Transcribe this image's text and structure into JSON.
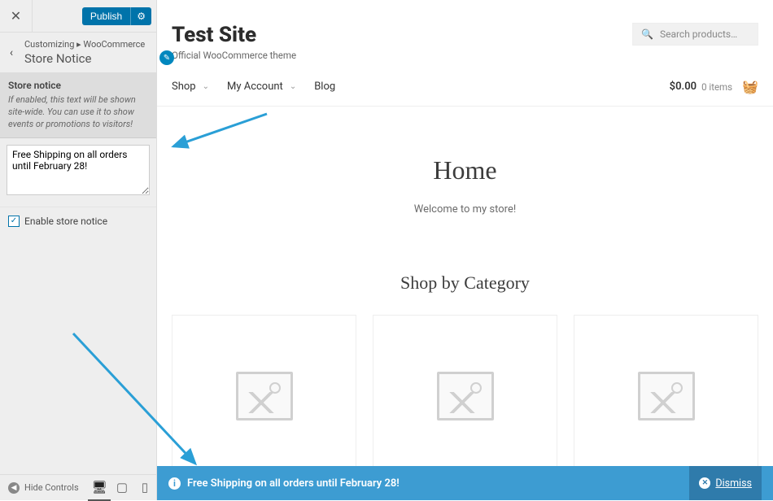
{
  "sidebar": {
    "publish_label": "Publish",
    "breadcrumb_trail": "Customizing ▸ WooCommerce",
    "page_title": "Store Notice",
    "section_title": "Store notice",
    "section_help": "If enabled, this text will be shown site-wide. You can use it to show events or promotions to visitors!",
    "notice_value": "Free Shipping on all orders until February 28!",
    "enable_label": "Enable store notice",
    "enable_checked": true,
    "hide_controls_label": "Hide Controls"
  },
  "preview": {
    "site_title": "Test Site",
    "tagline": "Official WooCommerce theme",
    "search_placeholder": "Search products…",
    "menu": {
      "shop": "Shop",
      "account": "My Account",
      "blog": "Blog"
    },
    "cart": {
      "price": "$0.00",
      "items": "0 items"
    },
    "home_heading": "Home",
    "welcome_text": "Welcome to my store!",
    "shop_by_category": "Shop by Category"
  },
  "store_notice": {
    "text": "Free Shipping on all orders until February 28!",
    "dismiss": "Dismiss"
  }
}
